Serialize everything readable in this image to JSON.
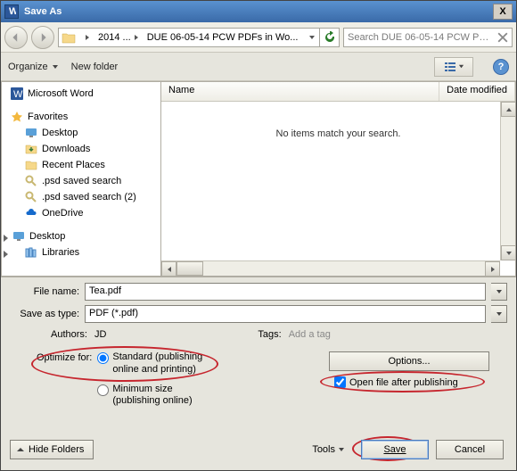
{
  "titlebar": {
    "title": "Save As",
    "close": "X"
  },
  "nav": {
    "breadcrumb1": "2014 ...",
    "breadcrumb2": "DUE 06-05-14 PCW PDFs in Wo...",
    "search_placeholder": "Search DUE 06-05-14 PCW PD..."
  },
  "toolbar": {
    "organize": "Organize",
    "new_folder": "New folder",
    "help": "?"
  },
  "tree": {
    "microsoft_word": "Microsoft Word",
    "favorites": "Favorites",
    "desktop": "Desktop",
    "downloads": "Downloads",
    "recent_places": "Recent Places",
    "psd_saved_search": ".psd saved search",
    "psd_saved_search_2": ".psd saved search (2)",
    "onedrive": "OneDrive",
    "desktop2": "Desktop",
    "libraries": "Libraries"
  },
  "file_pane": {
    "col_name": "Name",
    "col_date": "Date modified",
    "empty": "No items match your search."
  },
  "form": {
    "file_name_label": "File name:",
    "file_name_value": "Tea.pdf",
    "save_as_type_label": "Save as type:",
    "save_as_type_value": "PDF (*.pdf)",
    "authors_label": "Authors:",
    "authors_value": "JD",
    "tags_label": "Tags:",
    "tags_placeholder": "Add a tag"
  },
  "optimize": {
    "label": "Optimize for:",
    "standard_line1": "Standard (publishing",
    "standard_line2": "online and printing)",
    "min_line1": "Minimum size",
    "min_line2": "(publishing online)",
    "options_btn": "Options...",
    "open_after": "Open file after publishing"
  },
  "footer": {
    "hide_folders": "Hide Folders",
    "tools": "Tools",
    "save": "Save",
    "cancel": "Cancel"
  },
  "colors": {
    "annotation": "#c6262e",
    "accent": "#2b579a"
  }
}
